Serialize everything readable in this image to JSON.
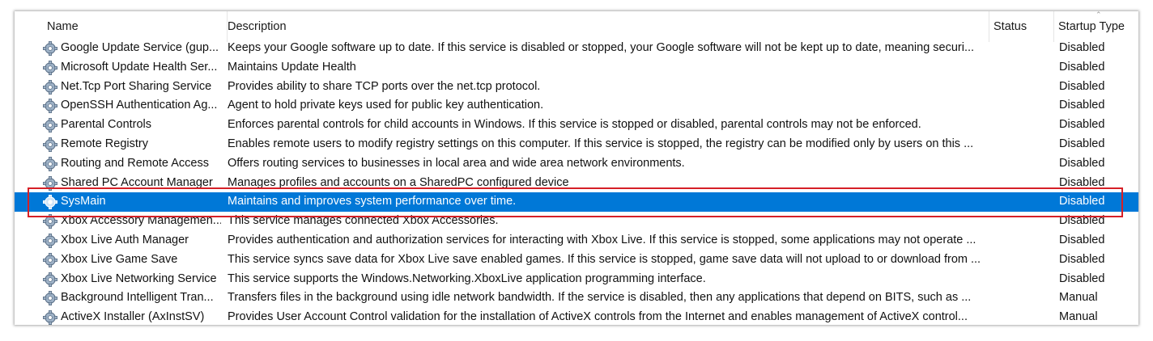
{
  "columns": {
    "name": "Name",
    "description": "Description",
    "status": "Status",
    "startup_type": "Startup Type"
  },
  "rows": [
    {
      "name": "Google Update Service (gup...",
      "description": "Keeps your Google software up to date. If this service is disabled or stopped, your Google software will not be kept up to date, meaning securi...",
      "status": "",
      "startup_type": "Disabled"
    },
    {
      "name": "Microsoft Update Health Ser...",
      "description": "Maintains Update Health",
      "status": "",
      "startup_type": "Disabled"
    },
    {
      "name": "Net.Tcp Port Sharing Service",
      "description": "Provides ability to share TCP ports over the net.tcp protocol.",
      "status": "",
      "startup_type": "Disabled"
    },
    {
      "name": "OpenSSH Authentication Ag...",
      "description": "Agent to hold private keys used for public key authentication.",
      "status": "",
      "startup_type": "Disabled"
    },
    {
      "name": "Parental Controls",
      "description": "Enforces parental controls for child accounts in Windows. If this service is stopped or disabled, parental controls may not be enforced.",
      "status": "",
      "startup_type": "Disabled"
    },
    {
      "name": "Remote Registry",
      "description": "Enables remote users to modify registry settings on this computer. If this service is stopped, the registry can be modified only by users on this ...",
      "status": "",
      "startup_type": "Disabled"
    },
    {
      "name": "Routing and Remote Access",
      "description": "Offers routing services to businesses in local area and wide area network environments.",
      "status": "",
      "startup_type": "Disabled"
    },
    {
      "name": "Shared PC Account Manager",
      "description": "Manages profiles and accounts on a SharedPC configured device",
      "status": "",
      "startup_type": "Disabled"
    },
    {
      "name": "SysMain",
      "description": "Maintains and improves system performance over time.",
      "status": "",
      "startup_type": "Disabled"
    },
    {
      "name": "Xbox Accessory Managemen...",
      "description": "This service manages connected Xbox Accessories.",
      "status": "",
      "startup_type": "Disabled"
    },
    {
      "name": "Xbox Live Auth Manager",
      "description": "Provides authentication and authorization services for interacting with Xbox Live. If this service is stopped, some applications may not operate ...",
      "status": "",
      "startup_type": "Disabled"
    },
    {
      "name": "Xbox Live Game Save",
      "description": "This service syncs save data for Xbox Live save enabled games.  If this service is stopped, game save data will not upload to or download from ...",
      "status": "",
      "startup_type": "Disabled"
    },
    {
      "name": "Xbox Live Networking Service",
      "description": "This service supports the Windows.Networking.XboxLive application programming interface.",
      "status": "",
      "startup_type": "Disabled"
    },
    {
      "name": "Background Intelligent Tran...",
      "description": "Transfers files in the background using idle network bandwidth. If the service is disabled, then any applications that depend on BITS, such as ...",
      "status": "",
      "startup_type": "Manual"
    },
    {
      "name": "ActiveX Installer (AxInstSV)",
      "description": "Provides User Account Control validation for the installation of ActiveX controls from the Internet and enables management of ActiveX control...",
      "status": "",
      "startup_type": "Manual"
    }
  ],
  "selected_row_index": 8,
  "colors": {
    "selection": "#0078d7",
    "highlight_box": "#d62027"
  },
  "row_icon": "service-gear-icon"
}
